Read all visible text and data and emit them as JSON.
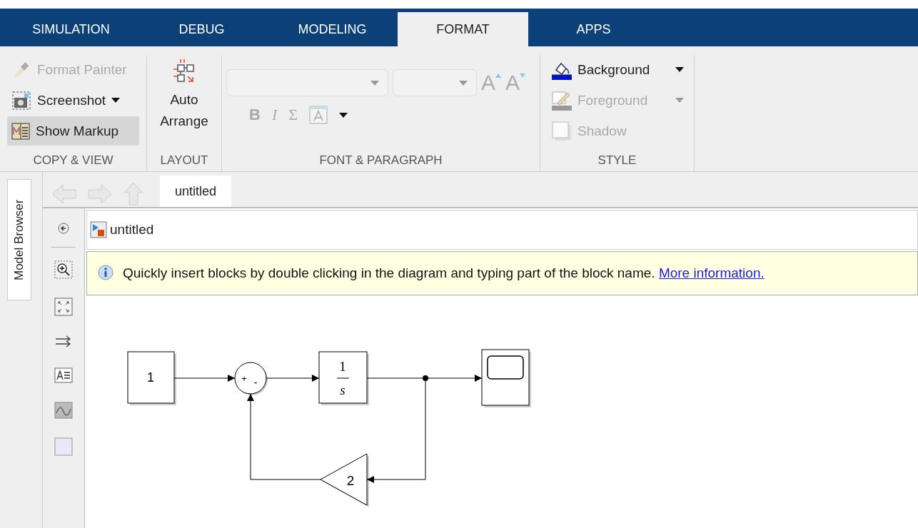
{
  "tabs": [
    {
      "label": "SIMULATION",
      "selected": false
    },
    {
      "label": "DEBUG",
      "selected": false
    },
    {
      "label": "MODELING",
      "selected": false
    },
    {
      "label": "FORMAT",
      "selected": true
    },
    {
      "label": "APPS",
      "selected": false
    }
  ],
  "ribbon": {
    "copy_view": {
      "label": "COPY & VIEW",
      "items": [
        {
          "kind": "painter",
          "label": "Format Painter",
          "disabled": true,
          "selected": false,
          "menu": false
        },
        {
          "kind": "screenshot",
          "label": "Screenshot",
          "disabled": false,
          "selected": false,
          "menu": true
        },
        {
          "kind": "markup",
          "label": "Show Markup",
          "disabled": false,
          "selected": true,
          "menu": false
        }
      ]
    },
    "layout": {
      "label": "LAYOUT",
      "button": {
        "label_lines": [
          "Auto",
          "Arrange"
        ]
      }
    },
    "font_paragraph": {
      "label": "FONT & PARAGRAPH",
      "disabled": true,
      "grow_label": "A",
      "shrink_label": "A",
      "bold": "B",
      "italic": "I",
      "sigma": "Σ"
    },
    "style": {
      "label": "STYLE",
      "items": [
        {
          "kind": "background",
          "label": "Background",
          "disabled": false,
          "menu": true
        },
        {
          "kind": "foreground",
          "label": "Foreground",
          "disabled": true,
          "menu": true
        },
        {
          "kind": "shadow",
          "label": "Shadow",
          "disabled": true,
          "menu": false
        }
      ]
    }
  },
  "side_tab": {
    "label": "Model Browser"
  },
  "document_tab": {
    "label": "untitled",
    "selected": true
  },
  "breadcrumb": {
    "label": "untitled"
  },
  "info_bar": {
    "text": "Quickly insert blocks by double clicking in the diagram and typing part of the block name.",
    "link": "More information."
  },
  "diagram": {
    "blocks": [
      {
        "kind": "constant",
        "label": "1"
      },
      {
        "kind": "sum",
        "signs": [
          "+",
          "-"
        ]
      },
      {
        "kind": "integrator",
        "numerator": "1",
        "denominator": "s"
      },
      {
        "kind": "scope"
      },
      {
        "kind": "gain",
        "label": "2"
      }
    ]
  }
}
